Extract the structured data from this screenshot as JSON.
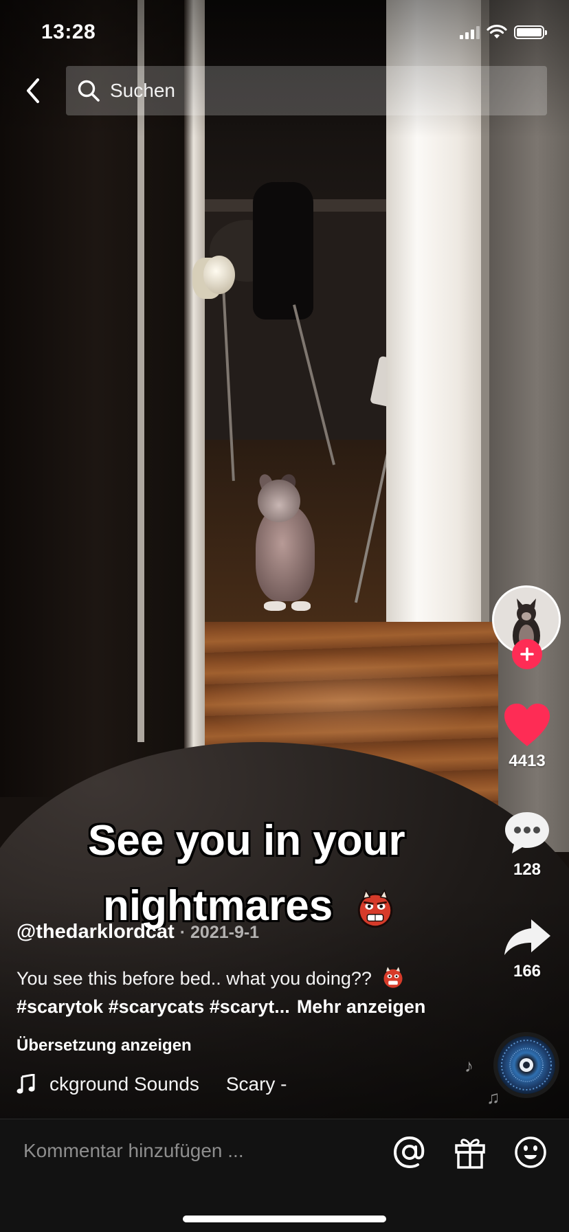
{
  "status_bar": {
    "time": "13:28",
    "battery_level": 1.0
  },
  "search": {
    "label": "Suchen",
    "back_icon": "chevron-left-icon",
    "search_icon": "search-icon"
  },
  "video": {
    "overlay_line_1": "See you in your",
    "overlay_line_2": "nightmares"
  },
  "post": {
    "author": "@thedarklordcat",
    "date": "· 2021-9-1",
    "description": "You see this before bed.. what you doing??",
    "hashtags": "#scarytok #scarycats #scaryt...",
    "more_label": "Mehr anzeigen",
    "translate_label": "Übersetzung anzeigen",
    "music_text": "ckground Sounds     Scary -"
  },
  "actions": {
    "likes": "4413",
    "comments": "128",
    "shares": "166",
    "like_color": "#fe2c55",
    "follow_color": "#fe2c55"
  },
  "comment_bar": {
    "placeholder": "Kommentar hinzufügen ..."
  }
}
